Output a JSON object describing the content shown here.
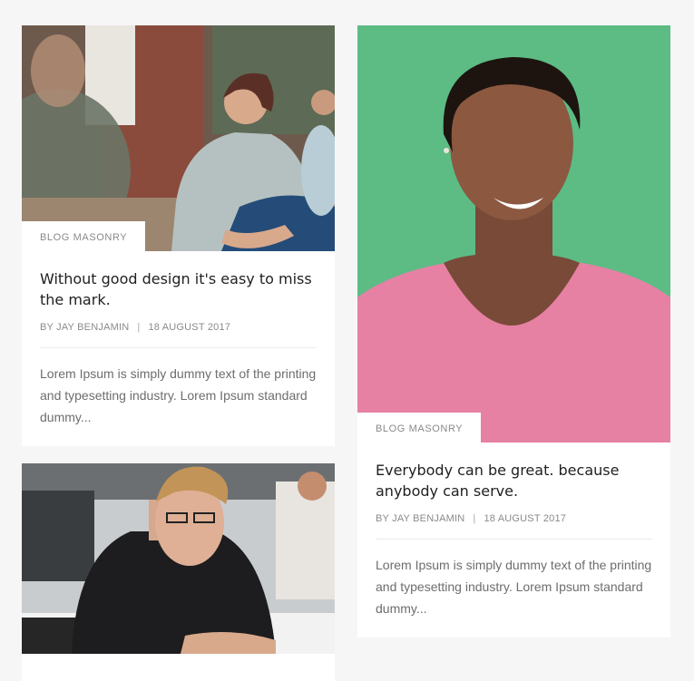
{
  "cards": [
    {
      "image": "woman-sitting-in-office-photo",
      "category": "BLOG MASONRY",
      "title": "Without good design it's easy to miss the mark.",
      "author": "BY JAY BENJAMIN",
      "separator": "|",
      "date": "18 AUGUST 2017",
      "excerpt": "Lorem Ipsum is simply dummy text of the printing and typesetting industry. Lorem Ipsum standard dummy..."
    },
    {
      "image": "smiling-woman-green-background-photo",
      "category": "BLOG MASONRY",
      "title": "Everybody can be great. because anybody can serve.",
      "author": "BY JAY BENJAMIN",
      "separator": "|",
      "date": "18 AUGUST 2017",
      "excerpt": "Lorem Ipsum is simply dummy text of the printing and typesetting industry. Lorem Ipsum standard dummy..."
    },
    {
      "image": "man-with-glasses-at-desk-photo"
    }
  ],
  "colors": {
    "page_background": "#f6f6f6",
    "card_background": "#ffffff",
    "title_text": "#1f1f1f",
    "meta_text": "#8a8a8a",
    "body_text": "#6d6d6d",
    "photo_green": "#5cbc84",
    "shirt_pink": "#e681a4"
  }
}
